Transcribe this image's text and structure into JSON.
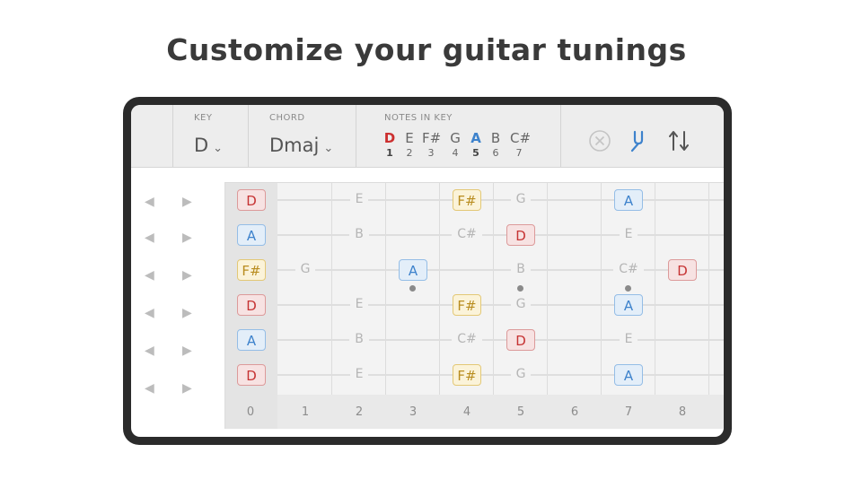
{
  "headline": "Customize your guitar tunings",
  "toolbar": {
    "key_label": "KEY",
    "key_value": "D",
    "chord_label": "CHORD",
    "chord_value": "Dmaj",
    "notes_label": "NOTES IN KEY",
    "notes": [
      {
        "note": "D",
        "degree": "1",
        "style": "red"
      },
      {
        "note": "E",
        "degree": "2",
        "style": "normal"
      },
      {
        "note": "F#",
        "degree": "3",
        "style": "normal"
      },
      {
        "note": "G",
        "degree": "4",
        "style": "normal"
      },
      {
        "note": "A",
        "degree": "5",
        "style": "blue"
      },
      {
        "note": "B",
        "degree": "6",
        "style": "normal"
      },
      {
        "note": "C#",
        "degree": "7",
        "style": "normal"
      }
    ],
    "icons": [
      "clear-icon",
      "tuning-fork-icon",
      "swap-icon"
    ]
  },
  "fret_numbers": [
    "0",
    "1",
    "2",
    "3",
    "4",
    "5",
    "6",
    "7",
    "8"
  ],
  "strings": [
    {
      "open": "D",
      "notes": [
        "",
        "E",
        "",
        "F#",
        "G",
        "",
        "A",
        ""
      ]
    },
    {
      "open": "A",
      "notes": [
        "",
        "B",
        "",
        "C#",
        "D",
        "",
        "E",
        ""
      ]
    },
    {
      "open": "F#",
      "notes": [
        "G",
        "",
        "A",
        "",
        "B",
        "",
        "C#",
        "D"
      ]
    },
    {
      "open": "D",
      "notes": [
        "",
        "E",
        "",
        "F#",
        "G",
        "",
        "A",
        ""
      ]
    },
    {
      "open": "A",
      "notes": [
        "",
        "B",
        "",
        "C#",
        "D",
        "",
        "E",
        ""
      ]
    },
    {
      "open": "D",
      "notes": [
        "",
        "E",
        "",
        "F#",
        "G",
        "",
        "A",
        ""
      ]
    }
  ],
  "highlight_colors": {
    "root": "#c63333",
    "fifth": "#3d82cc",
    "third": "#b98d20"
  },
  "arrows": {
    "left": "◀",
    "right": "▶"
  }
}
